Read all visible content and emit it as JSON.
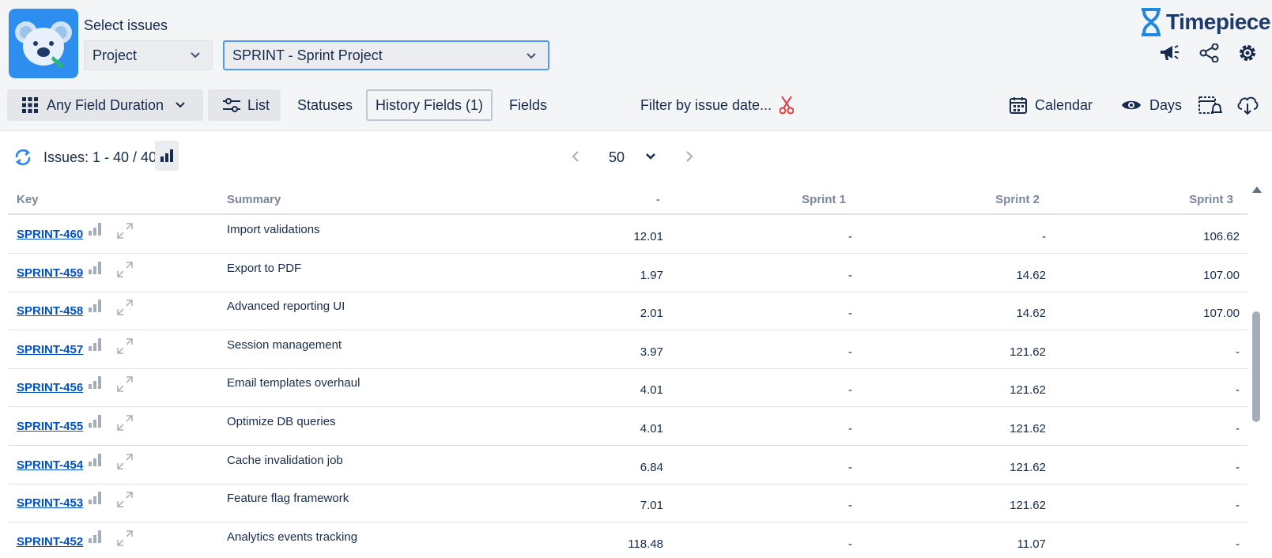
{
  "header": {
    "select_label": "Select issues",
    "project_dropdown": "Project",
    "sprint_dropdown": "SPRINT - Sprint Project",
    "brand": "Timepiece",
    "icons": [
      "announcement-icon",
      "share-icon",
      "gear-icon"
    ]
  },
  "toolbar": {
    "any_field_duration": "Any Field Duration",
    "list": "List",
    "statuses": "Statuses",
    "history_fields": "History Fields (1)",
    "fields": "Fields",
    "filter_by_issue_date": "Filter by issue date...",
    "calendar": "Calendar",
    "days": "Days"
  },
  "summary_bar": {
    "issues_count": "Issues: 1 - 40 / 40",
    "page_size": "50"
  },
  "table": {
    "columns": [
      "Key",
      "Summary",
      "-",
      "Sprint 1",
      "Sprint 2",
      "Sprint 3"
    ],
    "rows": [
      {
        "key": "SPRINT-460",
        "summary": "Import validations",
        "c0": "12.01",
        "c1": "-",
        "c2": "-",
        "c3": "106.62"
      },
      {
        "key": "SPRINT-459",
        "summary": "Export to PDF",
        "c0": "1.97",
        "c1": "-",
        "c2": "14.62",
        "c3": "107.00"
      },
      {
        "key": "SPRINT-458",
        "summary": "Advanced reporting UI",
        "c0": "2.01",
        "c1": "-",
        "c2": "14.62",
        "c3": "107.00"
      },
      {
        "key": "SPRINT-457",
        "summary": "Session management",
        "c0": "3.97",
        "c1": "-",
        "c2": "121.62",
        "c3": "-"
      },
      {
        "key": "SPRINT-456",
        "summary": "Email templates overhaul",
        "c0": "4.01",
        "c1": "-",
        "c2": "121.62",
        "c3": "-"
      },
      {
        "key": "SPRINT-455",
        "summary": "Optimize DB queries",
        "c0": "4.01",
        "c1": "-",
        "c2": "121.62",
        "c3": "-"
      },
      {
        "key": "SPRINT-454",
        "summary": "Cache invalidation job",
        "c0": "6.84",
        "c1": "-",
        "c2": "121.62",
        "c3": "-"
      },
      {
        "key": "SPRINT-453",
        "summary": "Feature flag framework",
        "c0": "7.01",
        "c1": "-",
        "c2": "121.62",
        "c3": "-"
      },
      {
        "key": "SPRINT-452",
        "summary": "Analytics events tracking",
        "c0": "118.48",
        "c1": "-",
        "c2": "11.07",
        "c3": "-"
      }
    ]
  },
  "colors": {
    "accent": "#0052cc",
    "logo_bg": "#2e8ef0",
    "filter_clear": "#e5383b"
  }
}
